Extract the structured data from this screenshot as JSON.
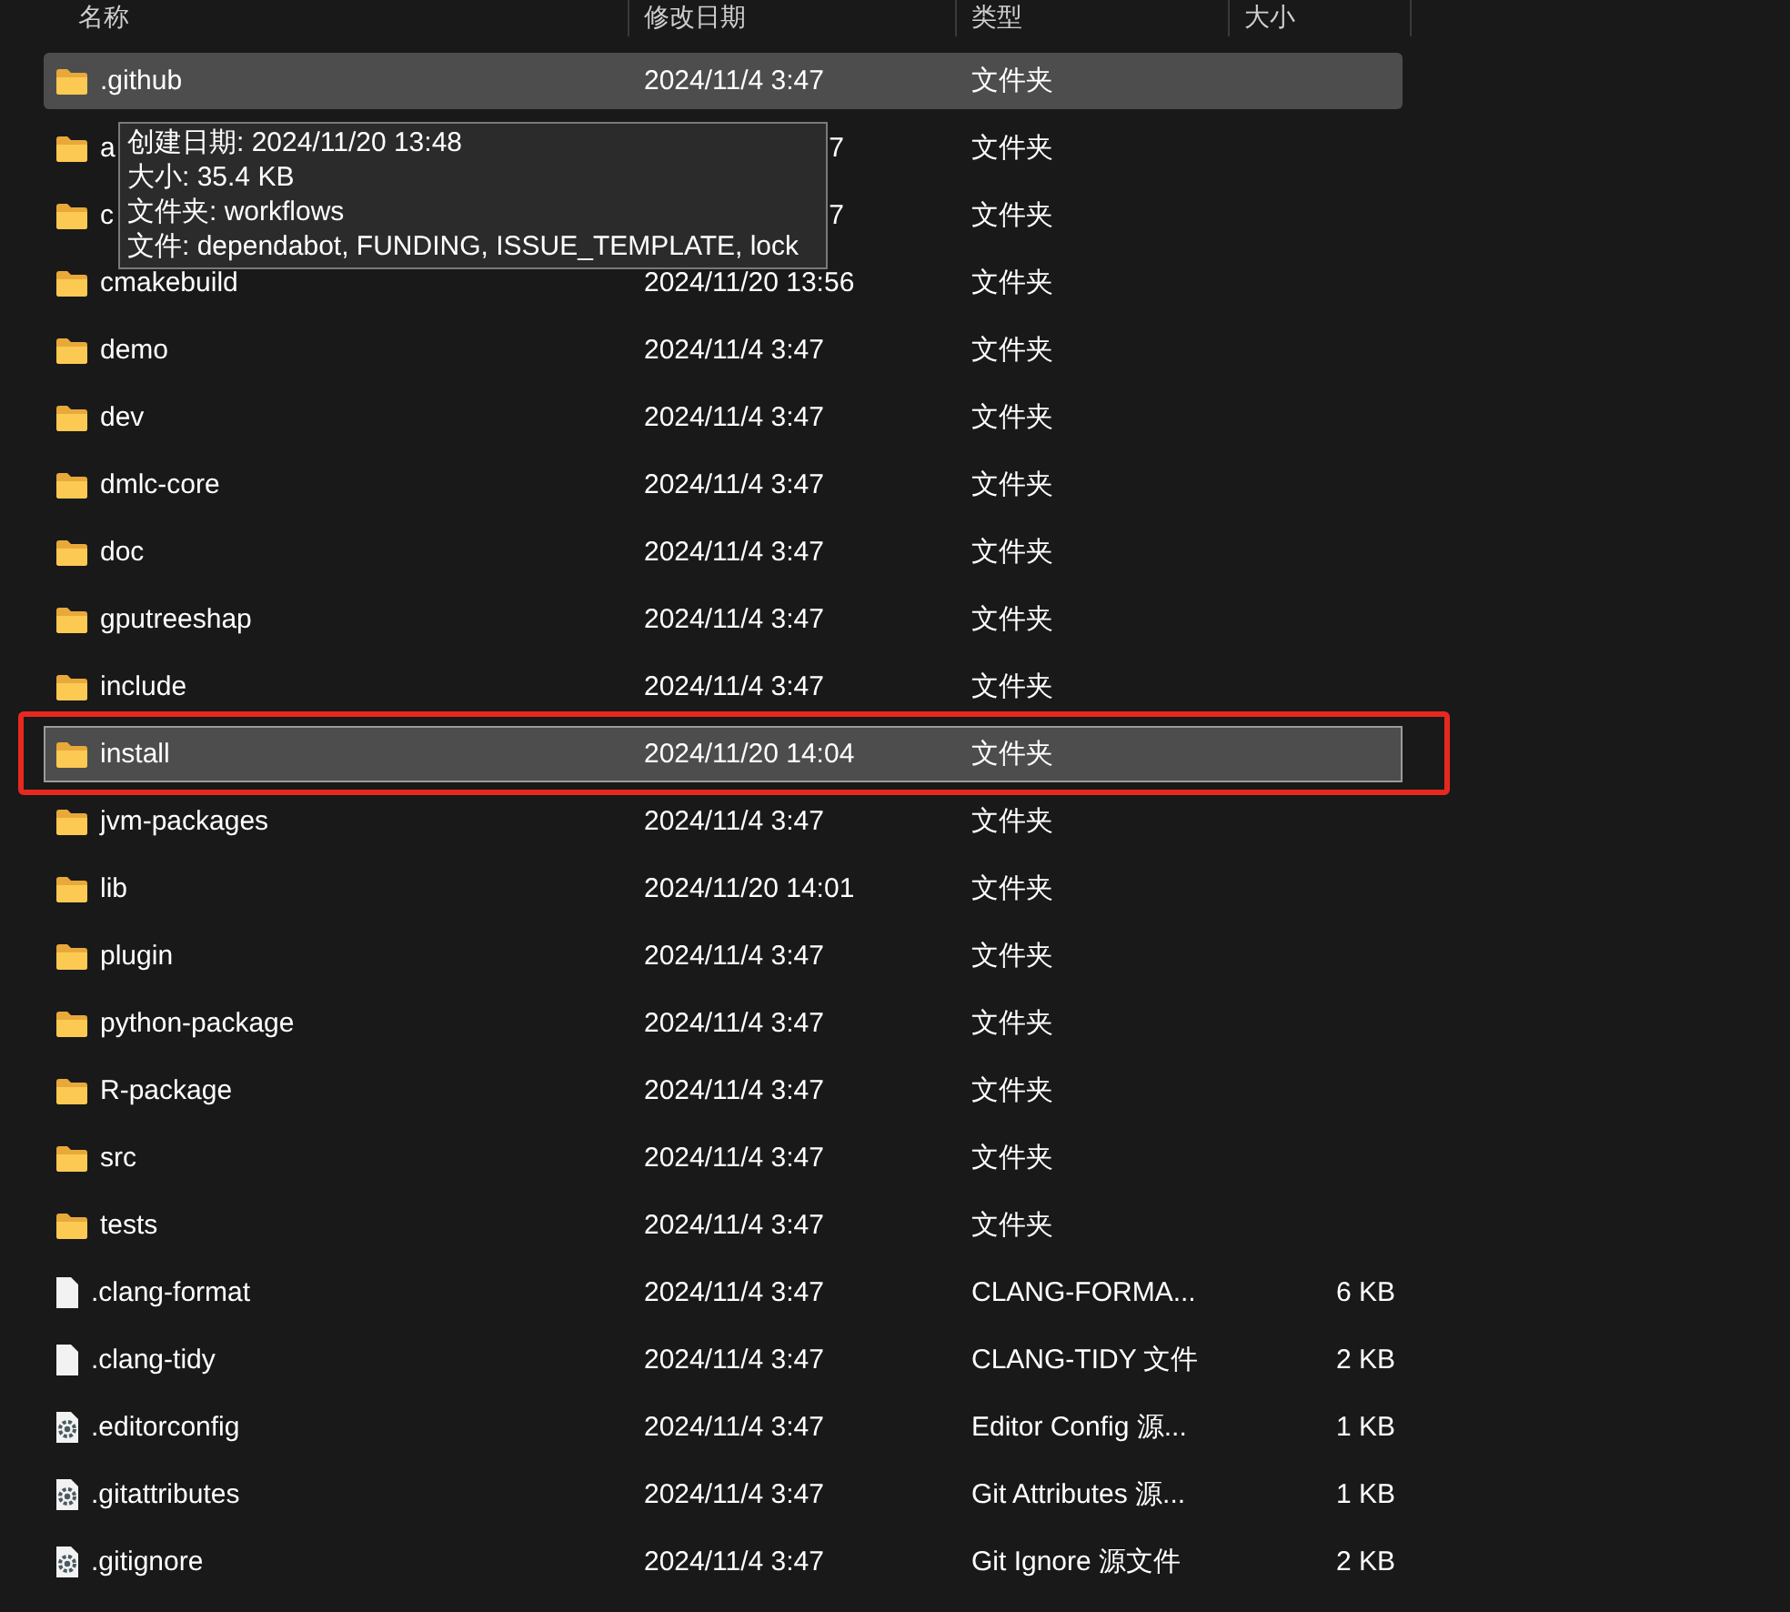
{
  "columns": [
    {
      "label": "名称"
    },
    {
      "label": "修改日期"
    },
    {
      "label": "类型"
    },
    {
      "label": "大小"
    }
  ],
  "rows": [
    {
      "kind": "folder",
      "name": ".github",
      "date": "2024/11/4 3:47",
      "type": "文件夹",
      "hovered": true,
      "selected": false
    },
    {
      "kind": "folder",
      "name": "a",
      "date": "7",
      "type": "文件夹",
      "partial": true,
      "hovered": false,
      "selected": false
    },
    {
      "kind": "folder",
      "name": "c",
      "date": "7",
      "type": "文件夹",
      "partial": true,
      "hovered": false,
      "selected": false
    },
    {
      "kind": "folder",
      "name": "cmakebuild",
      "date": "2024/11/20 13:56",
      "type": "文件夹",
      "hovered": false,
      "selected": false
    },
    {
      "kind": "folder",
      "name": "demo",
      "date": "2024/11/4 3:47",
      "type": "文件夹",
      "hovered": false,
      "selected": false
    },
    {
      "kind": "folder",
      "name": "dev",
      "date": "2024/11/4 3:47",
      "type": "文件夹",
      "hovered": false,
      "selected": false
    },
    {
      "kind": "folder",
      "name": "dmlc-core",
      "date": "2024/11/4 3:47",
      "type": "文件夹",
      "hovered": false,
      "selected": false
    },
    {
      "kind": "folder",
      "name": "doc",
      "date": "2024/11/4 3:47",
      "type": "文件夹",
      "hovered": false,
      "selected": false
    },
    {
      "kind": "folder",
      "name": "gputreeshap",
      "date": "2024/11/4 3:47",
      "type": "文件夹",
      "hovered": false,
      "selected": false
    },
    {
      "kind": "folder",
      "name": "include",
      "date": "2024/11/4 3:47",
      "type": "文件夹",
      "hovered": false,
      "selected": false
    },
    {
      "kind": "folder",
      "name": "install",
      "date": "2024/11/20 14:04",
      "type": "文件夹",
      "hovered": false,
      "selected": true,
      "highlighted": true
    },
    {
      "kind": "folder",
      "name": "jvm-packages",
      "date": "2024/11/4 3:47",
      "type": "文件夹",
      "hovered": false,
      "selected": false
    },
    {
      "kind": "folder",
      "name": "lib",
      "date": "2024/11/20 14:01",
      "type": "文件夹",
      "hovered": false,
      "selected": false
    },
    {
      "kind": "folder",
      "name": "plugin",
      "date": "2024/11/4 3:47",
      "type": "文件夹",
      "hovered": false,
      "selected": false
    },
    {
      "kind": "folder",
      "name": "python-package",
      "date": "2024/11/4 3:47",
      "type": "文件夹",
      "hovered": false,
      "selected": false
    },
    {
      "kind": "folder",
      "name": "R-package",
      "date": "2024/11/4 3:47",
      "type": "文件夹",
      "hovered": false,
      "selected": false
    },
    {
      "kind": "folder",
      "name": "src",
      "date": "2024/11/4 3:47",
      "type": "文件夹",
      "hovered": false,
      "selected": false
    },
    {
      "kind": "folder",
      "name": "tests",
      "date": "2024/11/4 3:47",
      "type": "文件夹",
      "hovered": false,
      "selected": false
    },
    {
      "kind": "file",
      "name": ".clang-format",
      "date": "2024/11/4 3:47",
      "type": "CLANG-FORMA...",
      "size": "6 KB",
      "hovered": false,
      "selected": false
    },
    {
      "kind": "file",
      "name": ".clang-tidy",
      "date": "2024/11/4 3:47",
      "type": "CLANG-TIDY 文件",
      "size": "2 KB",
      "hovered": false,
      "selected": false
    },
    {
      "kind": "config",
      "name": ".editorconfig",
      "date": "2024/11/4 3:47",
      "type": "Editor Config 源...",
      "size": "1 KB",
      "hovered": false,
      "selected": false
    },
    {
      "kind": "config",
      "name": ".gitattributes",
      "date": "2024/11/4 3:47",
      "type": "Git Attributes 源...",
      "size": "1 KB",
      "hovered": false,
      "selected": false
    },
    {
      "kind": "config",
      "name": ".gitignore",
      "date": "2024/11/4 3:47",
      "type": "Git Ignore 源文件",
      "size": "2 KB",
      "hovered": false,
      "selected": false
    }
  ],
  "tooltip": {
    "lines": [
      "创建日期: 2024/11/20 13:48",
      "大小: 35.4 KB",
      "文件夹: workflows",
      "文件: dependabot, FUNDING, ISSUE_TEMPLATE, lock"
    ]
  }
}
